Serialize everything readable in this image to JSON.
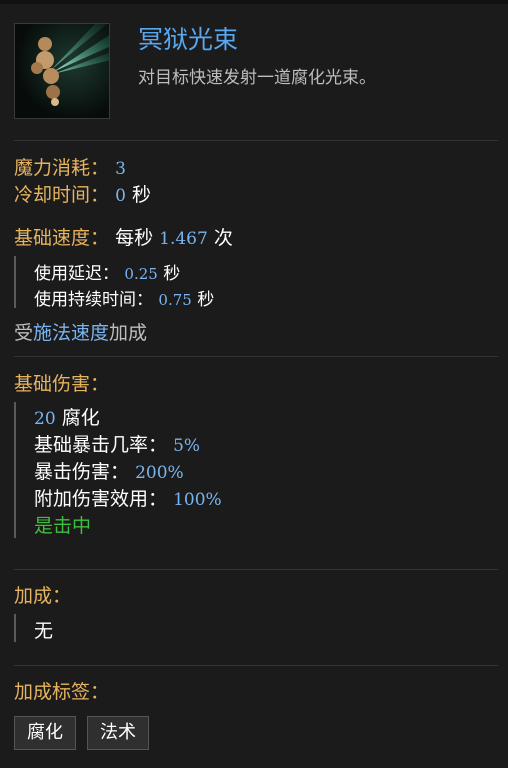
{
  "skill": {
    "name": "冥狱光束",
    "description": "对目标快速发射一道腐化光束。"
  },
  "cost": {
    "mana_label": "魔力消耗：",
    "mana_value": "3",
    "cooldown_label": "冷却时间：",
    "cooldown_value": "0",
    "cooldown_unit": "秒"
  },
  "speed": {
    "label": "基础速度：",
    "prefix": "每秒",
    "value": "1.467",
    "unit": "次",
    "delay_label": "使用延迟：",
    "delay_value": "0.25",
    "delay_unit": "秒",
    "duration_label": "使用持续时间：",
    "duration_value": "0.75",
    "duration_unit": "秒",
    "scaling_prefix": "受",
    "scaling_link": "施法速度",
    "scaling_suffix": "加成"
  },
  "damage": {
    "label": "基础伤害：",
    "amount": "20",
    "type": "腐化",
    "crit_chance_label": "基础暴击几率：",
    "crit_chance_value": "5%",
    "crit_damage_label": "暴击伤害：",
    "crit_damage_value": "200%",
    "effectiveness_label": "附加伤害效用：",
    "effectiveness_value": "100%",
    "on_hit": "是击中"
  },
  "bonus": {
    "label": "加成：",
    "value": "无"
  },
  "tags": {
    "label": "加成标签：",
    "items": [
      "腐化",
      "法术"
    ]
  },
  "colors": {
    "title": "#59a7ee",
    "label": "#e6b35e",
    "number": "#7ab4f0",
    "green": "#3fbf3f",
    "background": "#1b1b1b"
  },
  "icons": {
    "skill": "void-beam-icon"
  }
}
